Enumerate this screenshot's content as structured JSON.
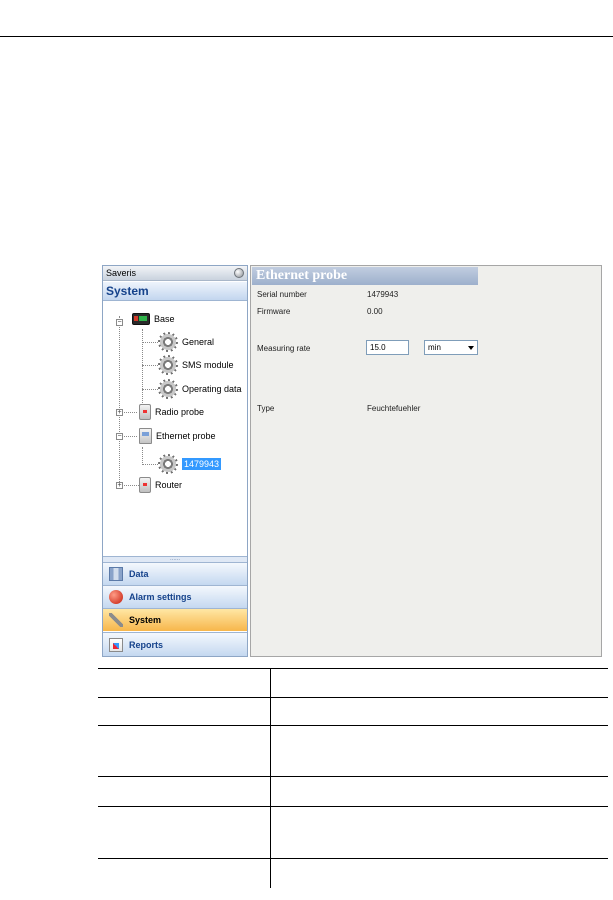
{
  "app": {
    "pane_title": "Saveris",
    "system_header": "System",
    "tree": {
      "base": "Base",
      "general": "General",
      "sms_module": "SMS module",
      "operating_data": "Operating data",
      "radio_probe": "Radio probe",
      "ethernet_probe": "Ethernet probe",
      "probe_serial": "1479943",
      "router": "Router"
    },
    "splitter_grip": "......",
    "nav_buttons": {
      "data": "Data",
      "alarm_settings": "Alarm settings",
      "system": "System",
      "reports": "Reports"
    },
    "content": {
      "title": "Ethernet probe",
      "serial_label": "Serial number",
      "serial_value": "1479943",
      "firmware_label": "Firmware",
      "firmware_value": "0.00",
      "rate_label": "Measuring rate",
      "rate_value": "15.0",
      "rate_unit": "min",
      "type_label": "Type",
      "type_value": "Feuchtefuehler"
    }
  },
  "table": {
    "row_count": 6
  }
}
